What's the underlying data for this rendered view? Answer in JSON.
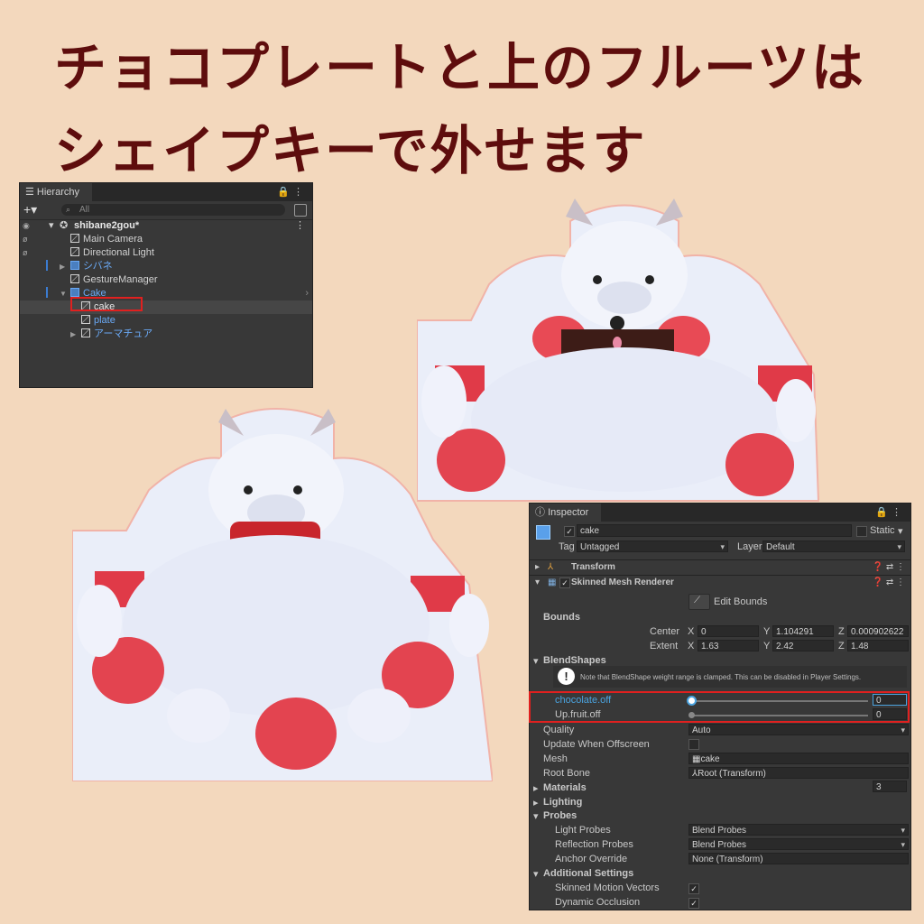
{
  "headline": {
    "line1": "チョコプレートと上のフルーツは",
    "line2": "シェイプキーで外せます"
  },
  "colors": {
    "background": "#f3d8bd",
    "headline": "#5e0d0d",
    "highlight": "#e0201f",
    "selected_text": "#4aa3df"
  },
  "hierarchy": {
    "tab": "Hierarchy",
    "search_placeholder": "All",
    "scene": "shibane2gou*",
    "items": [
      {
        "label": "Main Camera"
      },
      {
        "label": "Directional Light"
      },
      {
        "label": "シバネ"
      },
      {
        "label": "GestureManager"
      },
      {
        "label": "Cake"
      },
      {
        "label": "cake"
      },
      {
        "label": "plate"
      },
      {
        "label": "アーマチュア"
      }
    ]
  },
  "inspector": {
    "tab": "Inspector",
    "object_name": "cake",
    "static_label": "Static",
    "tag_label": "Tag",
    "tag_value": "Untagged",
    "layer_label": "Layer",
    "layer_value": "Default",
    "transform": "Transform",
    "smr": "Skinned Mesh Renderer",
    "edit_bounds": "Edit Bounds",
    "bounds": "Bounds",
    "center_label": "Center",
    "extent_label": "Extent",
    "center": {
      "x": "0",
      "y": "1.104291",
      "z": "0.000902622"
    },
    "extent": {
      "x": "1.63",
      "y": "2.42",
      "z": "1.48"
    },
    "blendshapes": "BlendShapes",
    "note": "Note that BlendShape weight range is clamped. This can be disabled in Player Settings.",
    "shape1_label": "chocolate.off",
    "shape1_value": "0",
    "shape2_label": "Up.fruit.off",
    "shape2_value": "0",
    "quality_label": "Quality",
    "quality_value": "Auto",
    "update_label": "Update When Offscreen",
    "mesh_label": "Mesh",
    "mesh_value": "cake",
    "rootbone_label": "Root Bone",
    "rootbone_value": "Root (Transform)",
    "materials": "Materials",
    "materials_count": "3",
    "lighting": "Lighting",
    "probes": "Probes",
    "light_probes_label": "Light Probes",
    "light_probes_value": "Blend Probes",
    "reflection_probes_label": "Reflection Probes",
    "reflection_probes_value": "Blend Probes",
    "anchor_label": "Anchor Override",
    "anchor_value": "None (Transform)",
    "additional": "Additional Settings",
    "smv_label": "Skinned Motion Vectors",
    "dyn_label": "Dynamic Occlusion"
  }
}
